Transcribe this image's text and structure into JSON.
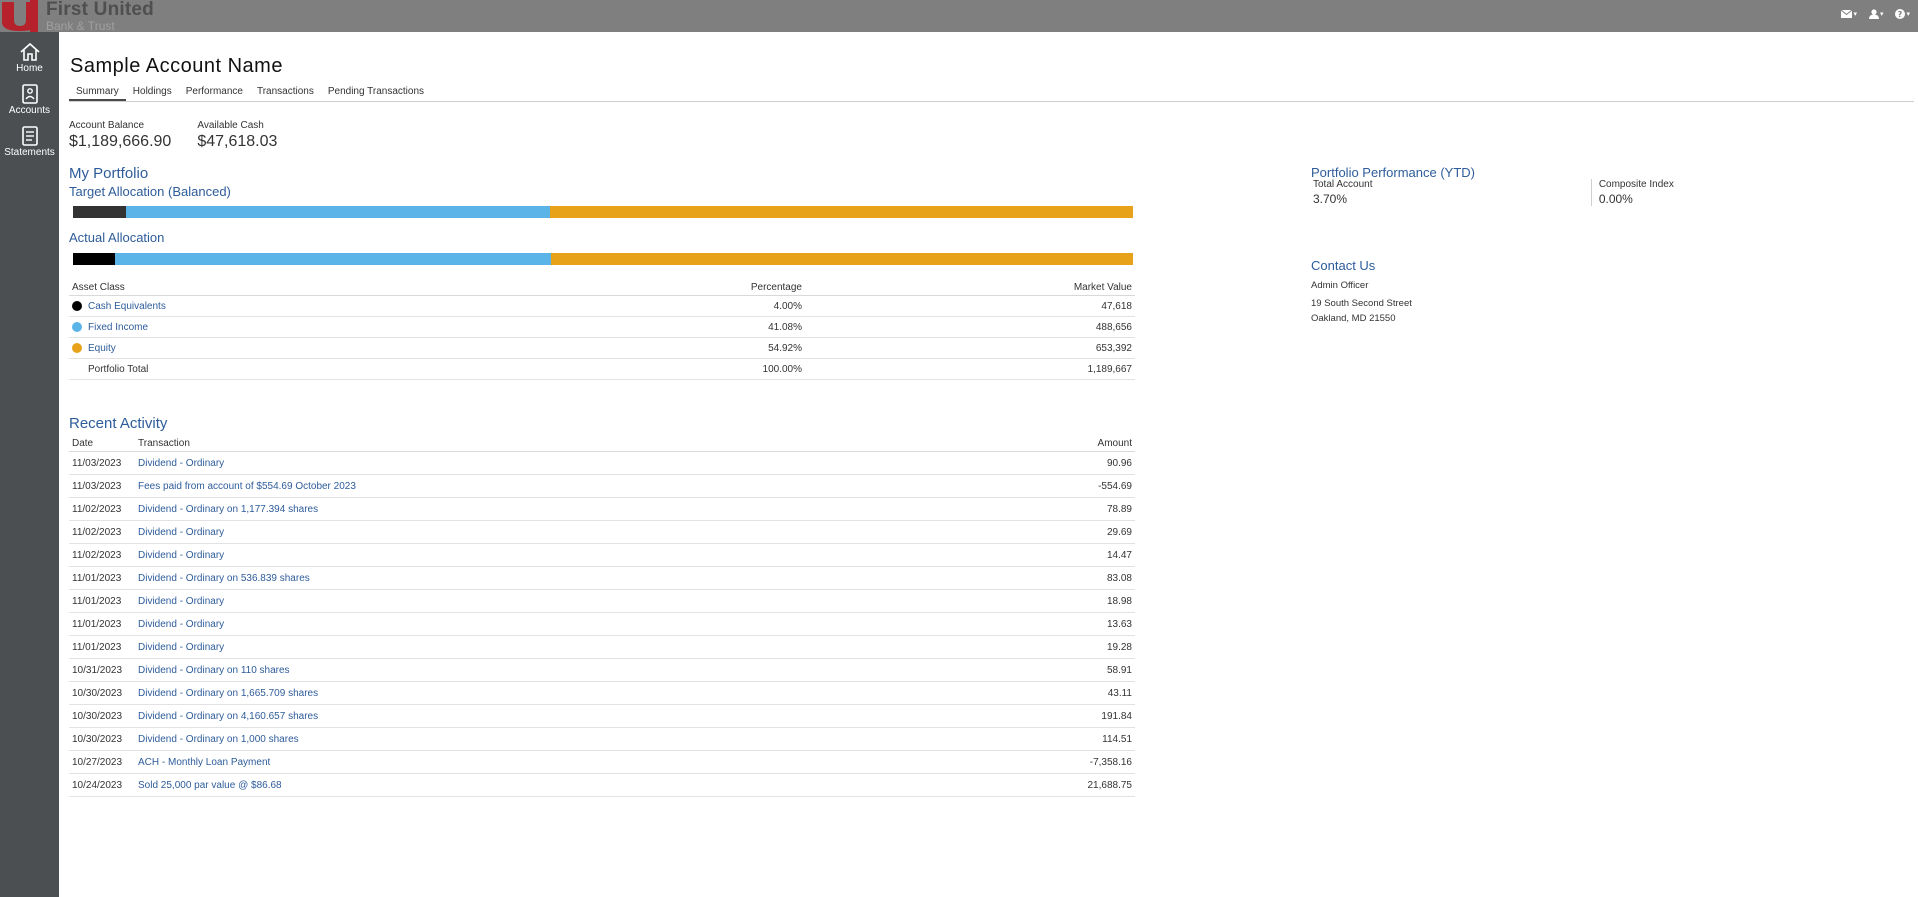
{
  "brand": {
    "name": "First United",
    "sub": "Bank & Trust",
    "colors": {
      "logo_red": "#b5222b",
      "topbar": "#7f7f7f",
      "sidebar": "#4b4f52"
    }
  },
  "top_icons": [
    {
      "name": "mail-icon"
    },
    {
      "name": "user-icon"
    },
    {
      "name": "help-icon"
    }
  ],
  "sidebar": {
    "items": [
      {
        "label": "Home",
        "icon": "home-icon"
      },
      {
        "label": "Accounts",
        "icon": "accounts-icon"
      },
      {
        "label": "Statements",
        "icon": "statements-icon"
      }
    ]
  },
  "account": {
    "title": "Sample Account Name",
    "tabs": [
      "Summary",
      "Holdings",
      "Performance",
      "Transactions",
      "Pending Transactions"
    ],
    "active_tab": "Summary",
    "balance_label": "Account Balance",
    "balance_value": "$1,189,666.90",
    "cash_label": "Available Cash",
    "cash_value": "$47,618.03"
  },
  "portfolio": {
    "title": "My Portfolio",
    "target_title": "Target Allocation (Balanced)",
    "actual_title": "Actual Allocation",
    "colors": {
      "cash": "#000000",
      "cash_target": "#333333",
      "fixed": "#5ab4e8",
      "equity": "#e8a21a"
    },
    "target_allocation": [
      5,
      40,
      55
    ],
    "actual_allocation": [
      4.0,
      41.08,
      54.92
    ],
    "table": {
      "headers": {
        "asset": "Asset Class",
        "pct": "Percentage",
        "mv": "Market Value"
      },
      "rows": [
        {
          "name": "Cash Equivalents",
          "pct": "4.00%",
          "mv": "47,618",
          "color": "#000000"
        },
        {
          "name": "Fixed Income",
          "pct": "41.08%",
          "mv": "488,656",
          "color": "#5ab4e8"
        },
        {
          "name": "Equity",
          "pct": "54.92%",
          "mv": "653,392",
          "color": "#e8a21a"
        }
      ],
      "total": {
        "name": "Portfolio Total",
        "pct": "100.00%",
        "mv": "1,189,667"
      }
    }
  },
  "activity": {
    "title": "Recent Activity",
    "headers": {
      "date": "Date",
      "txn": "Transaction",
      "amt": "Amount"
    },
    "rows": [
      {
        "date": "11/03/2023",
        "txn": "Dividend - Ordinary",
        "amt": "90.96"
      },
      {
        "date": "11/03/2023",
        "txn": "Fees paid from account of $554.69 October 2023",
        "amt": "-554.69"
      },
      {
        "date": "11/02/2023",
        "txn": "Dividend - Ordinary on 1,177.394 shares",
        "amt": "78.89"
      },
      {
        "date": "11/02/2023",
        "txn": "Dividend - Ordinary",
        "amt": "29.69"
      },
      {
        "date": "11/02/2023",
        "txn": "Dividend - Ordinary",
        "amt": "14.47"
      },
      {
        "date": "11/01/2023",
        "txn": "Dividend - Ordinary on 536.839 shares",
        "amt": "83.08"
      },
      {
        "date": "11/01/2023",
        "txn": "Dividend - Ordinary",
        "amt": "18.98"
      },
      {
        "date": "11/01/2023",
        "txn": "Dividend - Ordinary",
        "amt": "13.63"
      },
      {
        "date": "11/01/2023",
        "txn": "Dividend - Ordinary",
        "amt": "19.28"
      },
      {
        "date": "10/31/2023",
        "txn": "Dividend - Ordinary on 110 shares",
        "amt": "58.91"
      },
      {
        "date": "10/30/2023",
        "txn": "Dividend - Ordinary on 1,665.709 shares",
        "amt": "43.11"
      },
      {
        "date": "10/30/2023",
        "txn": "Dividend - Ordinary on 4,160.657 shares",
        "amt": "191.84"
      },
      {
        "date": "10/30/2023",
        "txn": "Dividend - Ordinary on 1,000 shares",
        "amt": "114.51"
      },
      {
        "date": "10/27/2023",
        "txn": "ACH - Monthly Loan Payment",
        "amt": "-7,358.16"
      },
      {
        "date": "10/24/2023",
        "txn": "Sold 25,000 par value @ $86.68",
        "amt": "21,688.75"
      }
    ]
  },
  "performance": {
    "title": "Portfolio Performance (YTD)",
    "total_label": "Total Account",
    "total_value": "3.70%",
    "index_label": "Composite Index",
    "index_value": "0.00%"
  },
  "contact": {
    "title": "Contact Us",
    "officer": "Admin Officer",
    "address1": "19 South Second Street",
    "address2": "Oakland, MD 21550"
  }
}
